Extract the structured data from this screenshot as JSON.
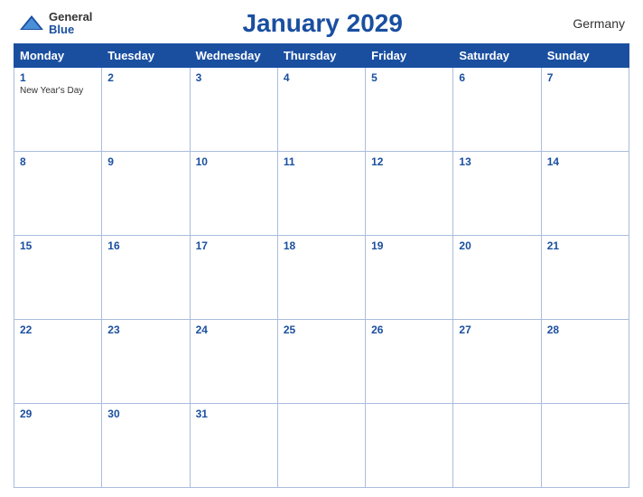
{
  "header": {
    "logo_general": "General",
    "logo_blue": "Blue",
    "title": "January 2029",
    "country": "Germany"
  },
  "calendar": {
    "weekdays": [
      "Monday",
      "Tuesday",
      "Wednesday",
      "Thursday",
      "Friday",
      "Saturday",
      "Sunday"
    ],
    "weeks": [
      [
        {
          "day": "1",
          "holiday": "New Year's Day"
        },
        {
          "day": "2",
          "holiday": ""
        },
        {
          "day": "3",
          "holiday": ""
        },
        {
          "day": "4",
          "holiday": ""
        },
        {
          "day": "5",
          "holiday": ""
        },
        {
          "day": "6",
          "holiday": ""
        },
        {
          "day": "7",
          "holiday": ""
        }
      ],
      [
        {
          "day": "8",
          "holiday": ""
        },
        {
          "day": "9",
          "holiday": ""
        },
        {
          "day": "10",
          "holiday": ""
        },
        {
          "day": "11",
          "holiday": ""
        },
        {
          "day": "12",
          "holiday": ""
        },
        {
          "day": "13",
          "holiday": ""
        },
        {
          "day": "14",
          "holiday": ""
        }
      ],
      [
        {
          "day": "15",
          "holiday": ""
        },
        {
          "day": "16",
          "holiday": ""
        },
        {
          "day": "17",
          "holiday": ""
        },
        {
          "day": "18",
          "holiday": ""
        },
        {
          "day": "19",
          "holiday": ""
        },
        {
          "day": "20",
          "holiday": ""
        },
        {
          "day": "21",
          "holiday": ""
        }
      ],
      [
        {
          "day": "22",
          "holiday": ""
        },
        {
          "day": "23",
          "holiday": ""
        },
        {
          "day": "24",
          "holiday": ""
        },
        {
          "day": "25",
          "holiday": ""
        },
        {
          "day": "26",
          "holiday": ""
        },
        {
          "day": "27",
          "holiday": ""
        },
        {
          "day": "28",
          "holiday": ""
        }
      ],
      [
        {
          "day": "29",
          "holiday": ""
        },
        {
          "day": "30",
          "holiday": ""
        },
        {
          "day": "31",
          "holiday": ""
        },
        {
          "day": "",
          "holiday": ""
        },
        {
          "day": "",
          "holiday": ""
        },
        {
          "day": "",
          "holiday": ""
        },
        {
          "day": "",
          "holiday": ""
        }
      ]
    ]
  }
}
